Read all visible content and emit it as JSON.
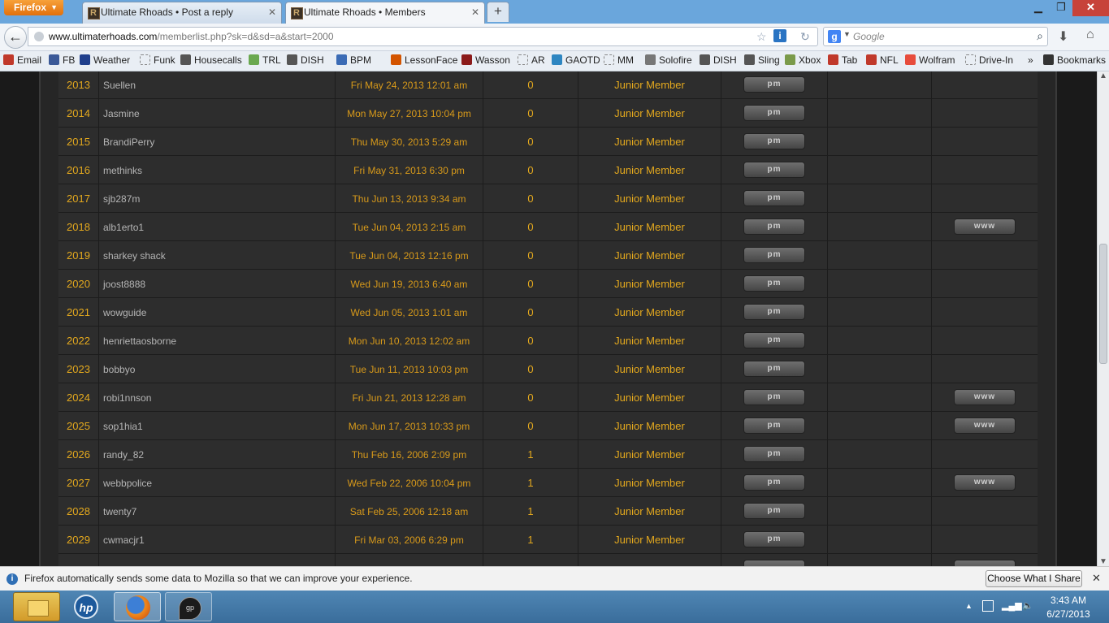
{
  "browser": {
    "menu_label": "Firefox",
    "tabs": [
      {
        "title": "Ultimate Rhoads • Post a reply"
      },
      {
        "title": "Ultimate Rhoads • Members"
      }
    ],
    "url_host": "www.ultimaterhoads.com",
    "url_path": "/memberlist.php?sk=d&sd=a&start=2000",
    "search_placeholder": "Google"
  },
  "bookmarks": [
    {
      "label": "Email",
      "icon": "email-icon",
      "color": "#c0392b"
    },
    {
      "label": "FB",
      "icon": "facebook-icon",
      "color": "#3b5998"
    },
    {
      "label": "Weather",
      "icon": "twc-icon",
      "color": "#1f3f8c"
    },
    {
      "label": "Funk",
      "icon": "blank-page-icon",
      "color": ""
    },
    {
      "label": "Housecalls",
      "icon": "housecalls-icon",
      "color": "#555555"
    },
    {
      "label": "TRL",
      "icon": "trl-icon",
      "color": "#6aa84f"
    },
    {
      "label": "DISH",
      "icon": "dish-icon",
      "color": "#555555"
    },
    {
      "label": "BPM",
      "icon": "bpm-icon",
      "color": "#3b6bb5"
    },
    {
      "label": "LessonFace",
      "icon": "lessonface-icon",
      "color": "#d35400"
    },
    {
      "label": "Wasson",
      "icon": "wasson-icon",
      "color": "#8b1a1a"
    },
    {
      "label": "AR",
      "icon": "blank-page-icon",
      "color": ""
    },
    {
      "label": "GAOTD",
      "icon": "gaotd-icon",
      "color": "#2e86c1"
    },
    {
      "label": "MM",
      "icon": "blank-page-icon",
      "color": ""
    },
    {
      "label": "Solofire",
      "icon": "solofire-icon",
      "color": "#777777"
    },
    {
      "label": "DISH",
      "icon": "dish-icon",
      "color": "#555555"
    },
    {
      "label": "Sling",
      "icon": "sling-icon",
      "color": "#555555"
    },
    {
      "label": "Xbox",
      "icon": "xbox-icon",
      "color": "#7a9a4a"
    },
    {
      "label": "Tab",
      "icon": "guitar-icon",
      "color": "#c0392b"
    },
    {
      "label": "NFL",
      "icon": "nfl-icon",
      "color": "#c0392b"
    },
    {
      "label": "Wolfram",
      "icon": "wolfram-icon",
      "color": "#e74c3c"
    },
    {
      "label": "Drive-In",
      "icon": "blank-page-icon",
      "color": ""
    }
  ],
  "bookmarks_overflow": "»",
  "bookmarks_menu_label": "Bookmarks",
  "members": [
    {
      "rank": "2013",
      "name": "Suellen",
      "joined": "Fri May 24, 2013 12:01 am",
      "posts": "0",
      "rank_title": "Junior Member",
      "pm": "pm",
      "www": ""
    },
    {
      "rank": "2014",
      "name": "Jasmine",
      "joined": "Mon May 27, 2013 10:04 pm",
      "posts": "0",
      "rank_title": "Junior Member",
      "pm": "pm",
      "www": ""
    },
    {
      "rank": "2015",
      "name": "BrandiPerry",
      "joined": "Thu May 30, 2013 5:29 am",
      "posts": "0",
      "rank_title": "Junior Member",
      "pm": "pm",
      "www": ""
    },
    {
      "rank": "2016",
      "name": "methinks",
      "joined": "Fri May 31, 2013 6:30 pm",
      "posts": "0",
      "rank_title": "Junior Member",
      "pm": "pm",
      "www": ""
    },
    {
      "rank": "2017",
      "name": "sjb287m",
      "joined": "Thu Jun 13, 2013 9:34 am",
      "posts": "0",
      "rank_title": "Junior Member",
      "pm": "pm",
      "www": ""
    },
    {
      "rank": "2018",
      "name": "alb1erto1",
      "joined": "Tue Jun 04, 2013 2:15 am",
      "posts": "0",
      "rank_title": "Junior Member",
      "pm": "pm",
      "www": "www"
    },
    {
      "rank": "2019",
      "name": "sharkey shack",
      "joined": "Tue Jun 04, 2013 12:16 pm",
      "posts": "0",
      "rank_title": "Junior Member",
      "pm": "pm",
      "www": ""
    },
    {
      "rank": "2020",
      "name": "joost8888",
      "joined": "Wed Jun 19, 2013 6:40 am",
      "posts": "0",
      "rank_title": "Junior Member",
      "pm": "pm",
      "www": ""
    },
    {
      "rank": "2021",
      "name": "wowguide",
      "joined": "Wed Jun 05, 2013 1:01 am",
      "posts": "0",
      "rank_title": "Junior Member",
      "pm": "pm",
      "www": ""
    },
    {
      "rank": "2022",
      "name": "henriettaosborne",
      "joined": "Mon Jun 10, 2013 12:02 am",
      "posts": "0",
      "rank_title": "Junior Member",
      "pm": "pm",
      "www": ""
    },
    {
      "rank": "2023",
      "name": "bobbyo",
      "joined": "Tue Jun 11, 2013 10:03 pm",
      "posts": "0",
      "rank_title": "Junior Member",
      "pm": "pm",
      "www": ""
    },
    {
      "rank": "2024",
      "name": "robi1nnson",
      "joined": "Fri Jun 21, 2013 12:28 am",
      "posts": "0",
      "rank_title": "Junior Member",
      "pm": "pm",
      "www": "www"
    },
    {
      "rank": "2025",
      "name": "sop1hia1",
      "joined": "Mon Jun 17, 2013 10:33 pm",
      "posts": "0",
      "rank_title": "Junior Member",
      "pm": "pm",
      "www": "www"
    },
    {
      "rank": "2026",
      "name": "randy_82",
      "joined": "Thu Feb 16, 2006 2:09 pm",
      "posts": "1",
      "rank_title": "Junior Member",
      "pm": "pm",
      "www": ""
    },
    {
      "rank": "2027",
      "name": "webbpolice",
      "joined": "Wed Feb 22, 2006 10:04 pm",
      "posts": "1",
      "rank_title": "Junior Member",
      "pm": "pm",
      "www": "www"
    },
    {
      "rank": "2028",
      "name": "twenty7",
      "joined": "Sat Feb 25, 2006 12:18 am",
      "posts": "1",
      "rank_title": "Junior Member",
      "pm": "pm",
      "www": ""
    },
    {
      "rank": "2029",
      "name": "cwmacjr1",
      "joined": "Fri Mar 03, 2006 6:29 pm",
      "posts": "1",
      "rank_title": "Junior Member",
      "pm": "pm",
      "www": ""
    },
    {
      "rank": "",
      "name": "",
      "joined": "",
      "posts": "",
      "rank_title": "",
      "pm": "",
      "www": ""
    }
  ],
  "notification": {
    "text": "Firefox automatically sends some data to Mozilla so that we can improve your experience.",
    "button": "Choose What I Share"
  },
  "taskbar": {
    "time": "3:43 AM",
    "date": "6/27/2013",
    "apps": [
      "file-explorer-icon",
      "hp-icon",
      "firefox-icon",
      "guitar-pro-icon"
    ]
  }
}
